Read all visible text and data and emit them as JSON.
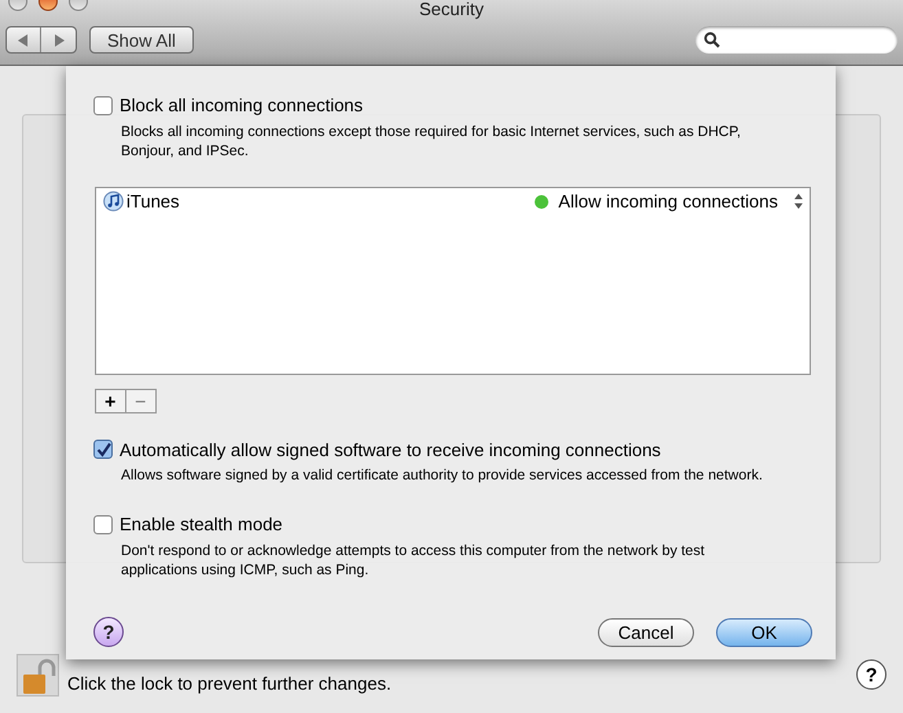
{
  "window": {
    "title": "Security"
  },
  "toolbar": {
    "show_all": "Show All"
  },
  "sheet": {
    "block_incoming": {
      "label": "Block all incoming connections",
      "description": "Blocks all incoming connections except those required for basic Internet services, such as DHCP, Bonjour, and IPSec.",
      "checked": false
    },
    "apps": [
      {
        "name": "iTunes",
        "status": "Allow incoming connections",
        "color": "#4cc23a"
      }
    ],
    "list_buttons": [
      "+",
      "−"
    ],
    "signed_software": {
      "label": "Automatically allow signed software to receive incoming connections",
      "description": "Allows software signed by a valid certificate authority to provide services accessed from the network.",
      "checked": true
    },
    "stealth_mode": {
      "label": "Enable stealth mode",
      "description": "Don't respond to or acknowledge attempts to access this computer from the network by test applications using ICMP, such as Ping.",
      "checked": false
    },
    "help": "?",
    "buttons": [
      {
        "label": "Cancel",
        "default": false
      },
      {
        "label": "OK",
        "default": true
      }
    ]
  },
  "footer": {
    "locked": false,
    "text": "Click the lock to prevent further changes.",
    "help": "?"
  }
}
